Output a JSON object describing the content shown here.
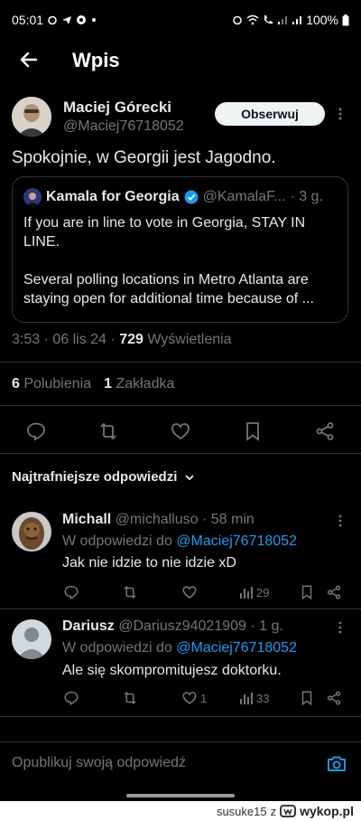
{
  "status_bar": {
    "time": "05:01",
    "battery": "100%"
  },
  "header": {
    "title": "Wpis"
  },
  "post": {
    "author_name": "Maciej Górecki",
    "author_handle": "@Maciej76718052",
    "follow_label": "Obserwuj",
    "text": "Spokojnie, w Georgii jest Jagodno.",
    "quote": {
      "name": "Kamala for Georgia",
      "handle": "@KamalaF...",
      "time": "· 3 g.",
      "line1": "If you are in line to vote in Georgia, STAY IN LINE.",
      "line2": "Several polling locations in Metro Atlanta are staying open for additional time because of ..."
    },
    "meta_time": "3:53 · 06 lis 24 ·",
    "views": "729",
    "views_label": "Wyświetlenia",
    "likes": "6",
    "likes_label": "Polubienia",
    "bookmarks": "1",
    "bookmarks_label": "Zakładka"
  },
  "sort_label": "Najtrafniejsze odpowiedzi",
  "replies": [
    {
      "name": "Michall",
      "handle": "@michalluso",
      "time": "· 58 min",
      "reply_prefix": "W odpowiedzi do",
      "reply_to": "@Maciej76718052",
      "text": "Jak nie idzie to nie idzie xD",
      "likes": "",
      "views": "29"
    },
    {
      "name": "Dariusz",
      "handle": "@Dariusz94021909",
      "time": "· 1 g.",
      "reply_prefix": "W odpowiedzi do",
      "reply_to": "@Maciej76718052",
      "text": "Ale się skompromitujesz doktorku.",
      "likes": "1",
      "views": "33"
    }
  ],
  "composer": {
    "placeholder": "Opublikuj swoją odpowiedź"
  },
  "watermark": {
    "user": "susuke15",
    "sep": "z",
    "site": "wykop.pl"
  },
  "colors": {
    "bg": "#000000",
    "accent": "#1d9bf0",
    "muted": "#71767b",
    "text": "#e7e9ea",
    "border": "#2f3336"
  }
}
